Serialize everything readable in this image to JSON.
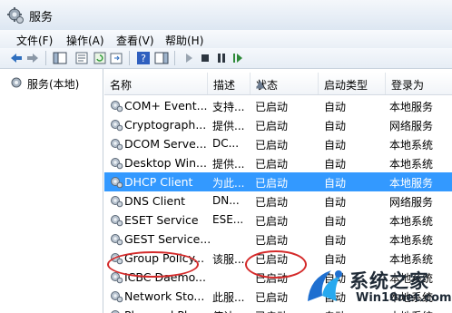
{
  "window": {
    "title": "服务"
  },
  "menu": [
    "文件(F)",
    "操作(A)",
    "查看(V)",
    "帮助(H)"
  ],
  "toolbar": {
    "buttons": [
      "back-icon",
      "forward-icon",
      "console-tree-icon",
      "properties-icon",
      "refresh-icon",
      "export-icon",
      "help-icon",
      "pane-icon",
      "play-icon",
      "stop-icon",
      "pause-icon",
      "restart-icon"
    ]
  },
  "tree": {
    "root_label": "服务(本地)"
  },
  "columns": [
    "名称",
    "描述",
    "状态",
    "启动类型",
    "登录为"
  ],
  "services": [
    {
      "name": "COM+ Event...",
      "desc": "支持...",
      "status": "已启动",
      "startup": "自动",
      "logon": "本地服务"
    },
    {
      "name": "Cryptograph...",
      "desc": "提供...",
      "status": "已启动",
      "startup": "自动",
      "logon": "网络服务"
    },
    {
      "name": "DCOM Serve...",
      "desc": "DC...",
      "status": "已启动",
      "startup": "自动",
      "logon": "本地系统"
    },
    {
      "name": "Desktop Win...",
      "desc": "提供...",
      "status": "已启动",
      "startup": "自动",
      "logon": "本地系统"
    },
    {
      "name": "DHCP Client",
      "desc": "为此...",
      "status": "已启动",
      "startup": "自动",
      "logon": "本地服务"
    },
    {
      "name": "DNS Client",
      "desc": "DN...",
      "status": "已启动",
      "startup": "自动",
      "logon": "网络服务"
    },
    {
      "name": "ESET Service",
      "desc": "ESE...",
      "status": "已启动",
      "startup": "自动",
      "logon": "本地系统"
    },
    {
      "name": "GEST Service...",
      "desc": "",
      "status": "已启动",
      "startup": "自动",
      "logon": "本地系统"
    },
    {
      "name": "Group Policy...",
      "desc": "该服...",
      "status": "已启动",
      "startup": "自动",
      "logon": "本地系统"
    },
    {
      "name": "ICBC Daemo...",
      "desc": "",
      "status": "已启动",
      "startup": "自动",
      "logon": "本地系统"
    },
    {
      "name": "Network Sto...",
      "desc": "此服...",
      "status": "已启动",
      "startup": "自动",
      "logon": "本地系统"
    },
    {
      "name": "Plug and Play",
      "desc": "使计...",
      "status": "已启动",
      "startup": "自动",
      "logon": "本地系统"
    }
  ],
  "selected_row": 4,
  "colors": {
    "selection": "#3399ff",
    "annotation": "#d42a2a"
  },
  "watermark": {
    "line1": "系统之家",
    "line2": "Win10net.com"
  }
}
